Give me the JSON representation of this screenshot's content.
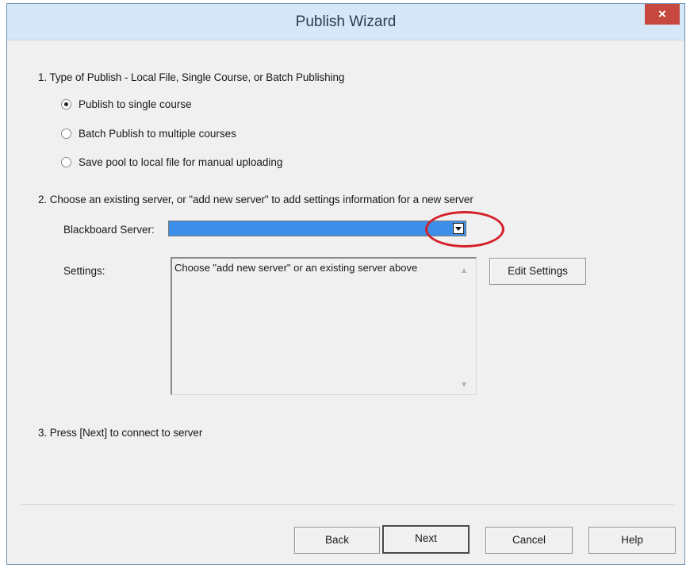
{
  "window": {
    "title": "Publish Wizard",
    "close_label": "×"
  },
  "steps": {
    "step1": "1.  Type of Publish - Local File, Single Course, or Batch Publishing",
    "step2": "2.  Choose an existing server, or \"add new server\" to add settings information for a new server",
    "step3": "3.  Press [Next] to connect to server"
  },
  "publish_options": [
    {
      "label": "Publish to single course",
      "checked": true
    },
    {
      "label": "Batch Publish to multiple courses",
      "checked": false
    },
    {
      "label": "Save pool to local file for manual uploading",
      "checked": false
    }
  ],
  "server": {
    "label": "Blackboard Server:",
    "selected_value": "",
    "arrow_icon": "chevron-down-icon"
  },
  "settings": {
    "label": "Settings:",
    "text": "Choose \"add new server\" or an existing server above",
    "edit_button": "Edit Settings"
  },
  "footer": {
    "back": "Back",
    "next": "Next",
    "cancel": "Cancel",
    "help": "Help"
  },
  "colors": {
    "title_bar": "#d6e7f8",
    "close_button": "#c7483f",
    "combo_selection": "#3d8ee8",
    "annotation_circle": "#d4202a"
  }
}
